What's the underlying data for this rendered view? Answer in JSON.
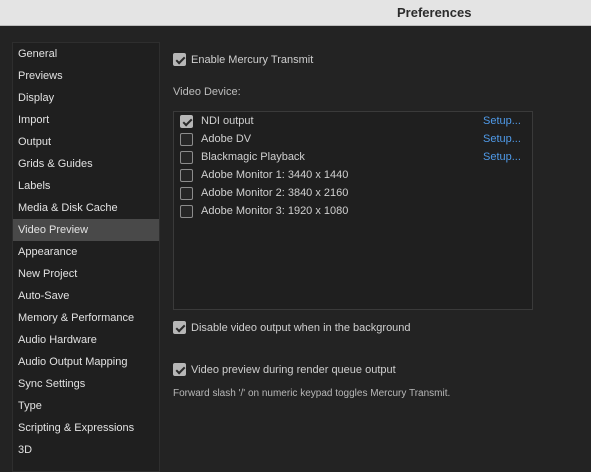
{
  "window": {
    "title": "Preferences"
  },
  "sidebar": {
    "items": [
      {
        "label": "General",
        "selected": false
      },
      {
        "label": "Previews",
        "selected": false
      },
      {
        "label": "Display",
        "selected": false
      },
      {
        "label": "Import",
        "selected": false
      },
      {
        "label": "Output",
        "selected": false
      },
      {
        "label": "Grids & Guides",
        "selected": false
      },
      {
        "label": "Labels",
        "selected": false
      },
      {
        "label": "Media & Disk Cache",
        "selected": false
      },
      {
        "label": "Video Preview",
        "selected": true
      },
      {
        "label": "Appearance",
        "selected": false
      },
      {
        "label": "New Project",
        "selected": false
      },
      {
        "label": "Auto-Save",
        "selected": false
      },
      {
        "label": "Memory & Performance",
        "selected": false
      },
      {
        "label": "Audio Hardware",
        "selected": false
      },
      {
        "label": "Audio Output Mapping",
        "selected": false
      },
      {
        "label": "Sync Settings",
        "selected": false
      },
      {
        "label": "Type",
        "selected": false
      },
      {
        "label": "Scripting & Expressions",
        "selected": false
      },
      {
        "label": "3D",
        "selected": false
      }
    ]
  },
  "main": {
    "enable_mercury": {
      "label": "Enable Mercury Transmit",
      "checked": true
    },
    "video_device_label": "Video Device:",
    "devices": [
      {
        "name": "NDI output",
        "checked": true,
        "setup": "Setup..."
      },
      {
        "name": "Adobe DV",
        "checked": false,
        "setup": "Setup..."
      },
      {
        "name": "Blackmagic Playback",
        "checked": false,
        "setup": "Setup..."
      },
      {
        "name": "Adobe Monitor 1: 3440 x 1440",
        "checked": false,
        "setup": ""
      },
      {
        "name": "Adobe Monitor 2: 3840 x 2160",
        "checked": false,
        "setup": ""
      },
      {
        "name": "Adobe Monitor 3: 1920 x 1080",
        "checked": false,
        "setup": ""
      }
    ],
    "disable_background": {
      "label": "Disable video output when in the background",
      "checked": true
    },
    "render_queue_preview": {
      "label": "Video preview during render queue output",
      "checked": true
    },
    "hint": "Forward slash '/' on numeric keypad toggles Mercury Transmit."
  },
  "colors": {
    "background": "#232323",
    "sidebar_selected": "#494949",
    "link": "#4f9ae8",
    "titlebar": "#e4e4e4"
  }
}
